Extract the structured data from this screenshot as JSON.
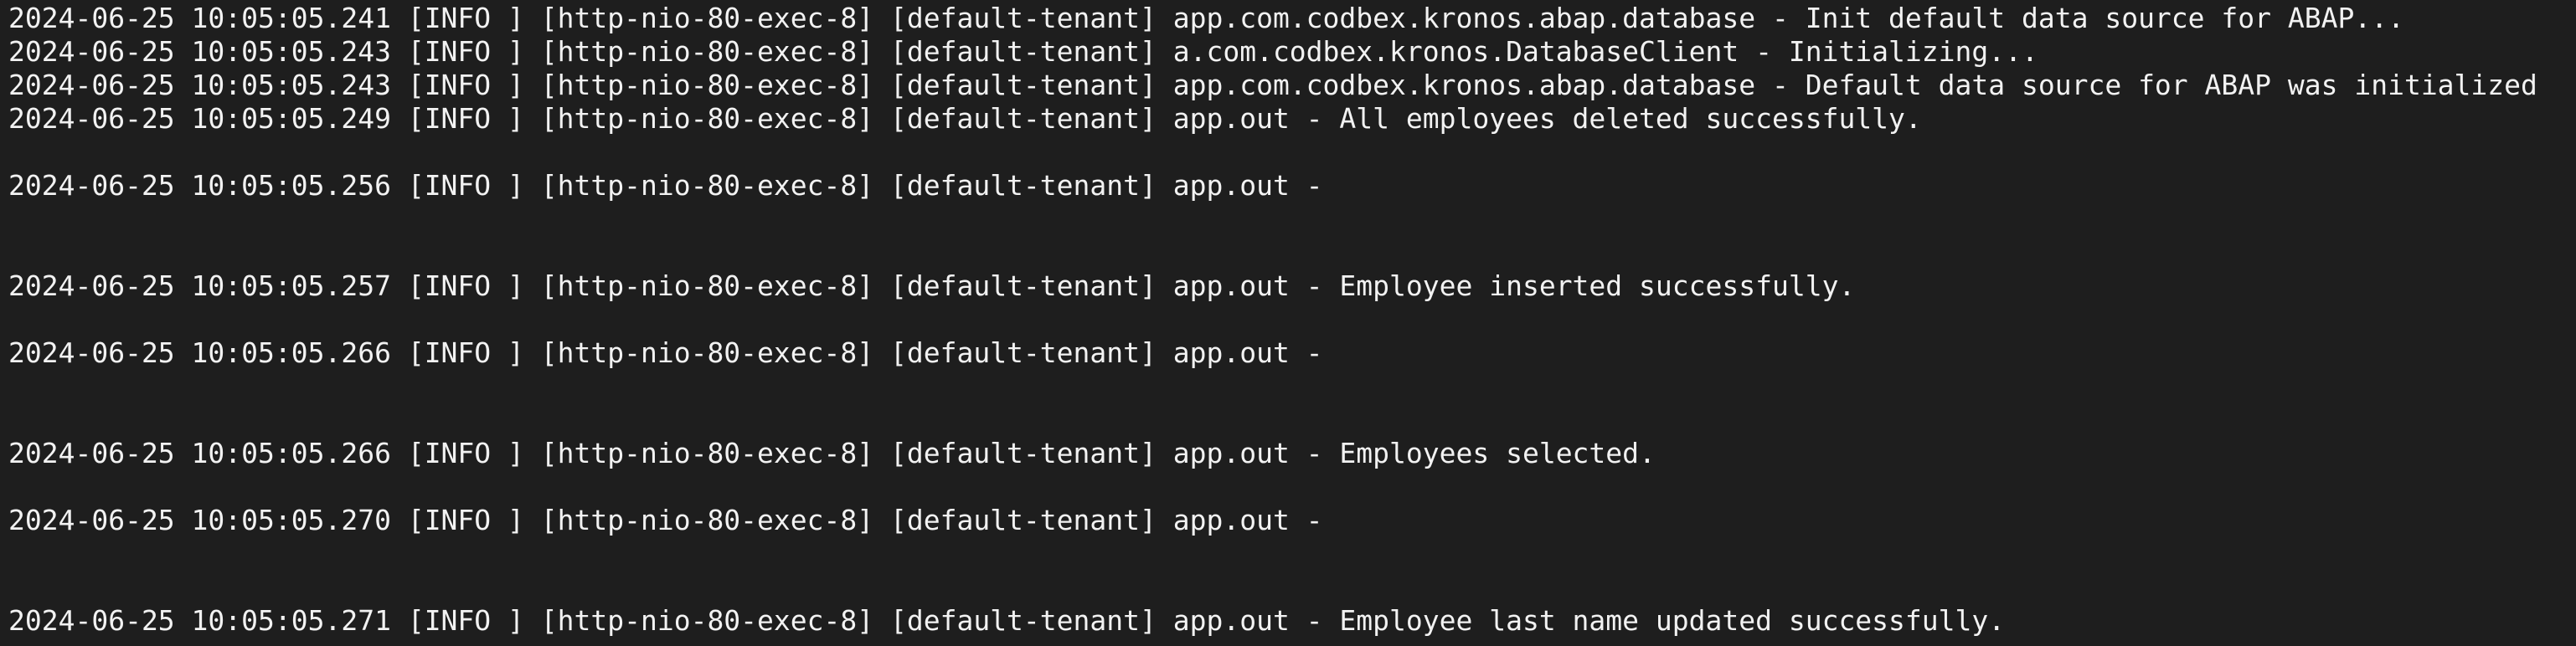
{
  "terminal": {
    "lines": [
      "2024-06-25 10:05:05.241 [INFO ] [http-nio-80-exec-8] [default-tenant] app.com.codbex.kronos.abap.database - Init default data source for ABAP...",
      "2024-06-25 10:05:05.243 [INFO ] [http-nio-80-exec-8] [default-tenant] a.com.codbex.kronos.DatabaseClient - Initializing...",
      "2024-06-25 10:05:05.243 [INFO ] [http-nio-80-exec-8] [default-tenant] app.com.codbex.kronos.abap.database - Default data source for ABAP was initialized",
      "2024-06-25 10:05:05.249 [INFO ] [http-nio-80-exec-8] [default-tenant] app.out - All employees deleted successfully.",
      "",
      "2024-06-25 10:05:05.256 [INFO ] [http-nio-80-exec-8] [default-tenant] app.out -",
      "",
      "",
      "2024-06-25 10:05:05.257 [INFO ] [http-nio-80-exec-8] [default-tenant] app.out - Employee inserted successfully.",
      "",
      "2024-06-25 10:05:05.266 [INFO ] [http-nio-80-exec-8] [default-tenant] app.out -",
      "",
      "",
      "2024-06-25 10:05:05.266 [INFO ] [http-nio-80-exec-8] [default-tenant] app.out - Employees selected.",
      "",
      "2024-06-25 10:05:05.270 [INFO ] [http-nio-80-exec-8] [default-tenant] app.out -",
      "",
      "",
      "2024-06-25 10:05:05.271 [INFO ] [http-nio-80-exec-8] [default-tenant] app.out - Employee last name updated successfully."
    ]
  }
}
